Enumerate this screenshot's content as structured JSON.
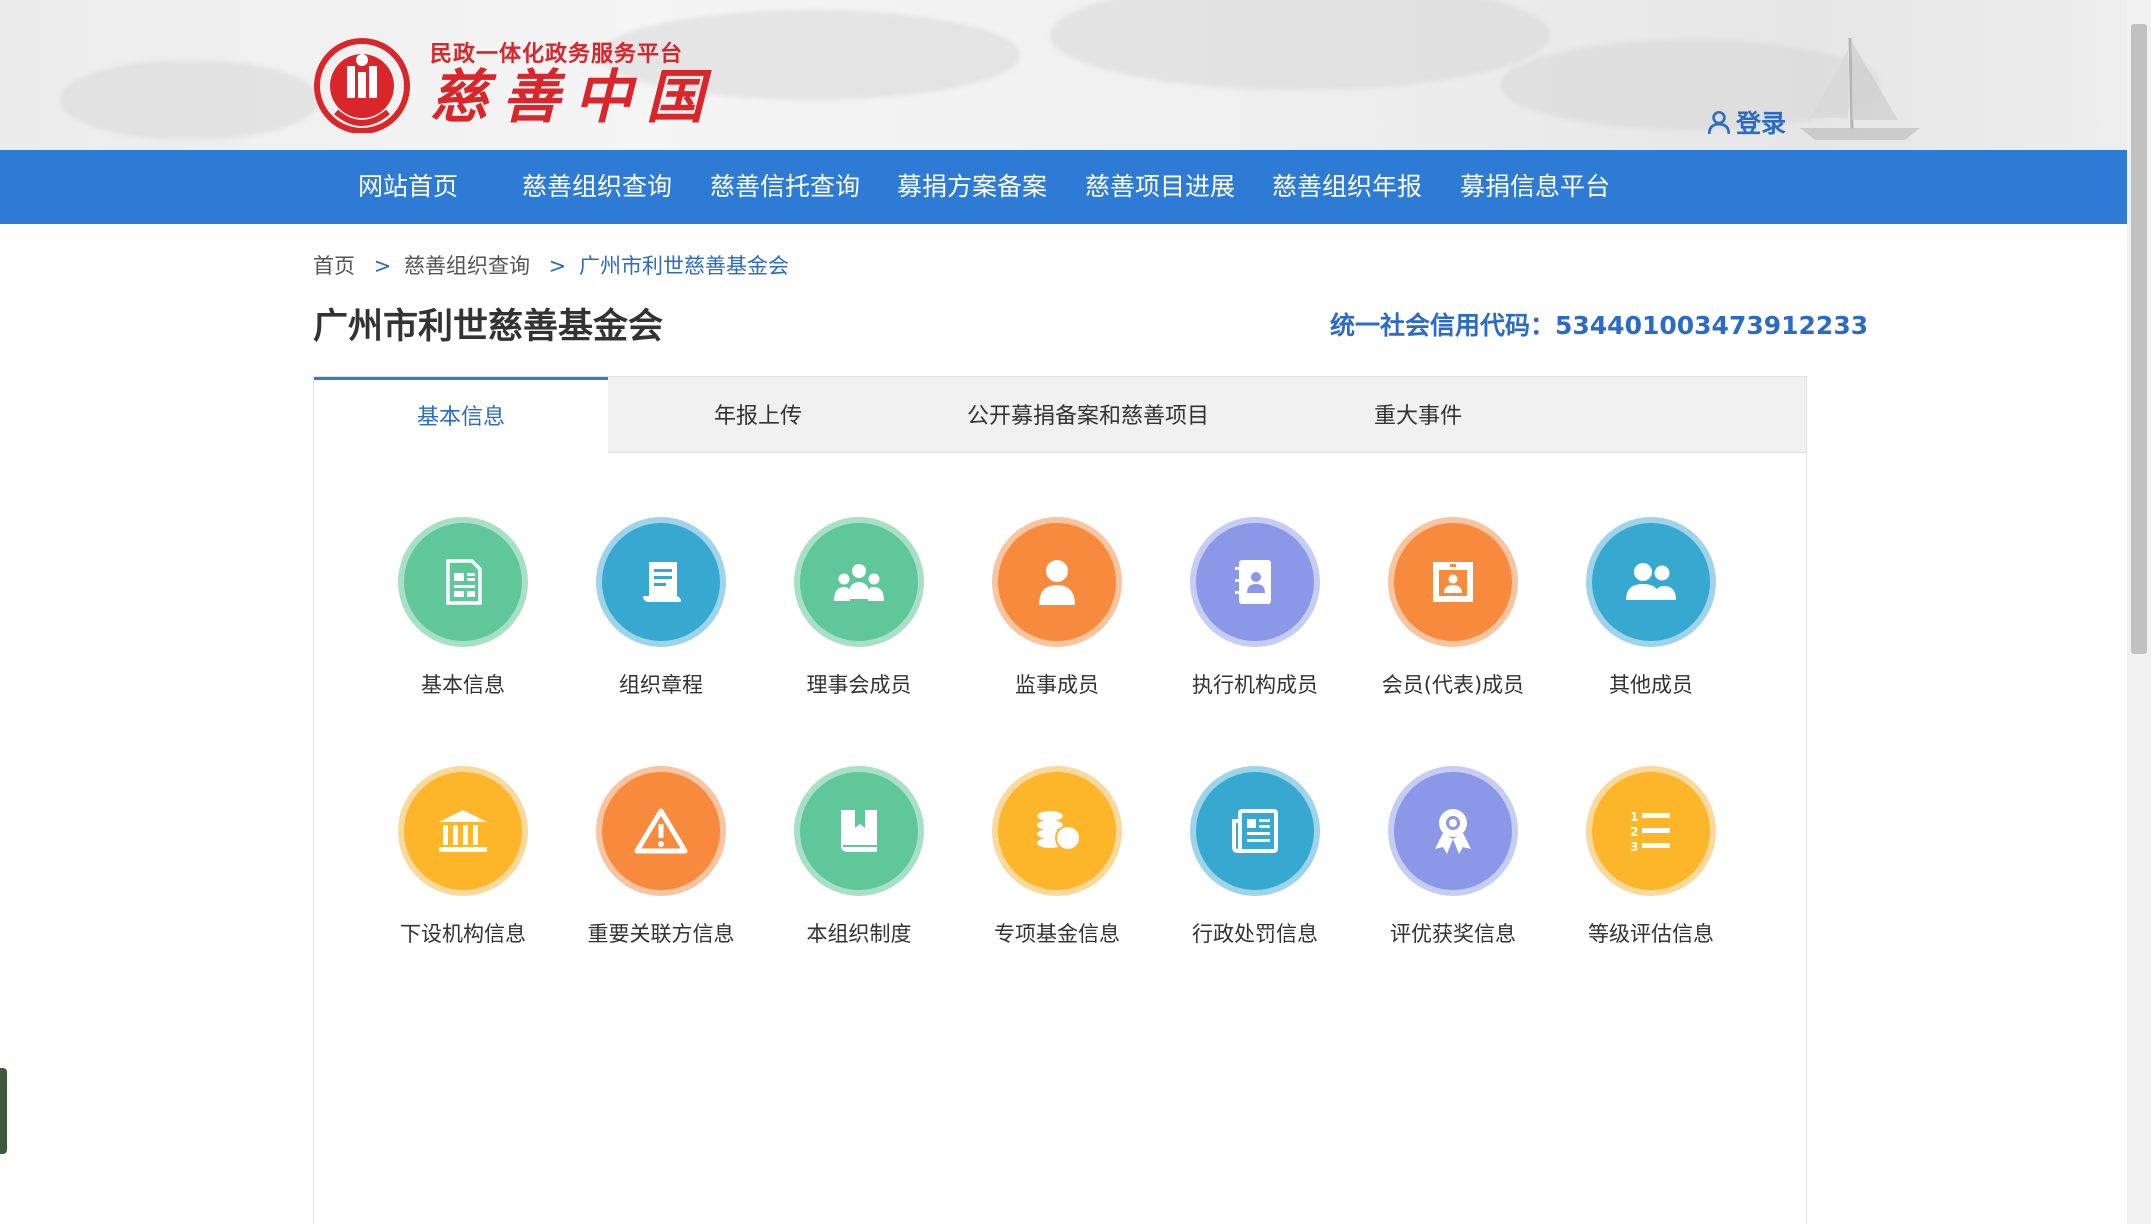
{
  "header": {
    "subtitle": "民政一体化政务服务平台",
    "brand": "慈善中国",
    "login_label": "登录",
    "brand_color": "#d8262b"
  },
  "nav": {
    "items": [
      "网站首页",
      "慈善组织查询",
      "慈善信托查询",
      "募捐方案备案",
      "慈善项目进展",
      "慈善组织年报",
      "募捐信息平台"
    ]
  },
  "breadcrumb": {
    "items": [
      "首页",
      "慈善组织查询",
      "广州市利世慈善基金会"
    ],
    "separator": ">"
  },
  "org": {
    "name": "广州市利世慈善基金会",
    "credit_code": "统一社会信用代码：534401003473912233"
  },
  "tabs": {
    "items": [
      "基本信息",
      "年报上传",
      "公开募捐备案和慈善项目",
      "重大事件"
    ],
    "active": "基本信息"
  },
  "tiles": {
    "row1": [
      {
        "label": "基本信息",
        "icon": "document-list-icon",
        "color": "green"
      },
      {
        "label": "组织章程",
        "icon": "scroll-icon",
        "color": "blue"
      },
      {
        "label": "理事会成员",
        "icon": "group-icon",
        "color": "green"
      },
      {
        "label": "监事成员",
        "icon": "person-icon",
        "color": "orange"
      },
      {
        "label": "执行机构成员",
        "icon": "contact-book-icon",
        "color": "purple"
      },
      {
        "label": "会员(代表)成员",
        "icon": "portrait-frame-icon",
        "color": "orange"
      },
      {
        "label": "其他成员",
        "icon": "users-icon",
        "color": "blue"
      }
    ],
    "row2": [
      {
        "label": "下设机构信息",
        "icon": "bank-icon",
        "color": "yellow"
      },
      {
        "label": "重要关联方信息",
        "icon": "warning-icon",
        "color": "orange"
      },
      {
        "label": "本组织制度",
        "icon": "book-icon",
        "color": "green"
      },
      {
        "label": "专项基金信息",
        "icon": "coins-icon",
        "color": "yellow"
      },
      {
        "label": "行政处罚信息",
        "icon": "newspaper-icon",
        "color": "blue"
      },
      {
        "label": "评优获奖信息",
        "icon": "award-icon",
        "color": "purple"
      },
      {
        "label": "等级评估信息",
        "icon": "numbered-list-icon",
        "color": "yellow"
      }
    ]
  },
  "colors": {
    "nav_blue": "#2e7bd6",
    "link_blue": "#2b6bc7"
  }
}
